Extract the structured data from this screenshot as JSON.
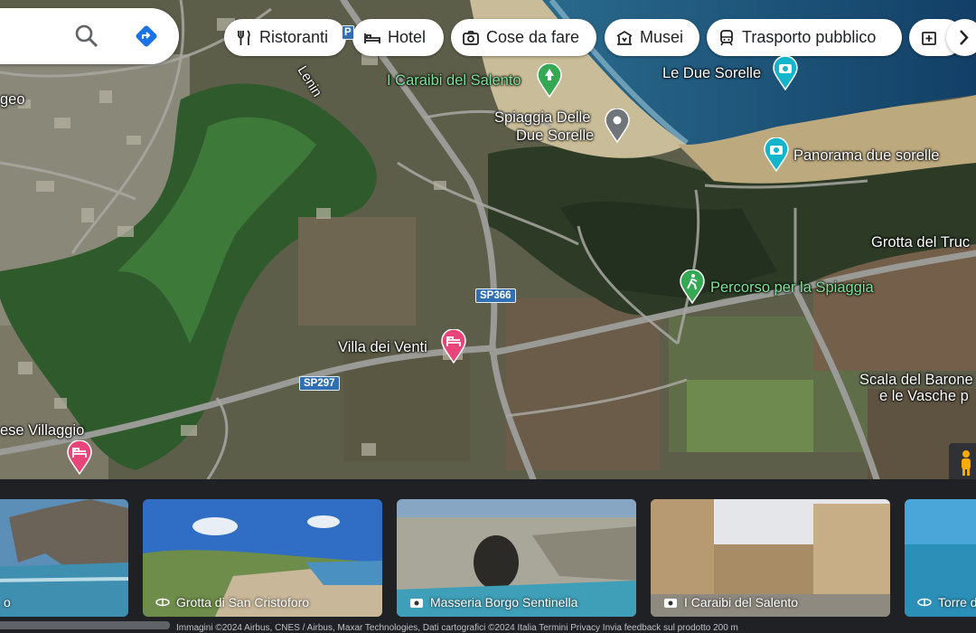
{
  "search": {
    "search_icon": "search-icon",
    "directions_icon": "directions-icon"
  },
  "chips": [
    {
      "label": "Ristoranti",
      "icon": "fork-knife-icon"
    },
    {
      "label": "Hotel",
      "icon": "bed-icon"
    },
    {
      "label": "Cose da fare",
      "icon": "camera-icon"
    },
    {
      "label": "Musei",
      "icon": "museum-icon"
    },
    {
      "label": "Trasporto pubblico",
      "icon": "train-icon"
    },
    {
      "label": "",
      "icon": "pharmacy-icon"
    }
  ],
  "chips_next_icon": "chevron-right-icon",
  "map": {
    "places": [
      {
        "name": "I Caraibi del Salento",
        "type": "park"
      },
      {
        "name": "Le Due Sorelle",
        "type": "viewpoint"
      },
      {
        "name": "Spiaggia Delle",
        "name_line2": "Due Sorelle",
        "type": "beach"
      },
      {
        "name": "Panorama due sorelle",
        "type": "viewpoint"
      },
      {
        "name": "Grotta del Truc",
        "type": "area"
      },
      {
        "name": "Percorso per la Spiaggia",
        "type": "trail"
      },
      {
        "name": "Villa dei Venti",
        "type": "hotel"
      },
      {
        "name": "Scala del Barone",
        "name_line2": "e le Vasche p",
        "type": "area"
      },
      {
        "name": "ese Villaggio",
        "type": "hotel"
      },
      {
        "name": "geo",
        "type": "area"
      },
      {
        "name": "Lenin",
        "type": "street"
      }
    ],
    "road_labels": [
      "SP366",
      "SP297",
      "P"
    ],
    "pegman_icon": "pegman-icon",
    "colors": {
      "pin_green": "#34a853",
      "pin_hotel": "#e8457a",
      "pin_photo": "#12b5cb",
      "pin_gray": "#70757a",
      "road_shield": "#2f6fb2"
    }
  },
  "photos": [
    {
      "caption": "o",
      "icon": ""
    },
    {
      "caption": "Grotta di San Cristoforo",
      "icon": "360-icon"
    },
    {
      "caption": "Masseria Borgo Sentinella",
      "icon": "camera-icon"
    },
    {
      "caption": "I Caraibi del Salento",
      "icon": "camera-icon"
    },
    {
      "caption": "Torre d",
      "icon": "360-icon"
    }
  ],
  "attribution": "Immagini ©2024 Airbus, CNES / Airbus, Maxar Technologies, Dati cartografici ©2024  Italia  Termini  Privacy  Invia feedback sul prodotto  200 m"
}
